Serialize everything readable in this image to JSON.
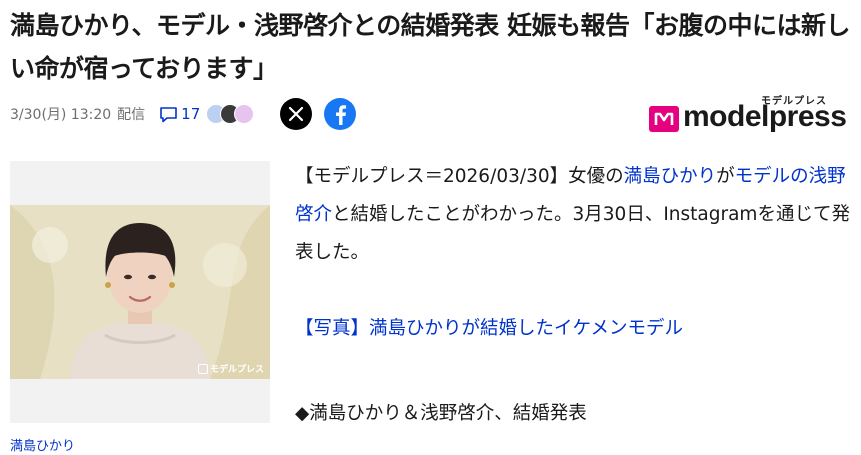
{
  "headline": "満島ひかり、モデル・浅野啓介との結婚発表 妊娠も報告「お腹の中には新しい命が宿っております」",
  "meta": {
    "datetime": "3/30(月) 13:20",
    "source_label": "配信",
    "comment_count": "17"
  },
  "share": {
    "x_icon": "x-logo-icon",
    "facebook_icon": "facebook-icon"
  },
  "logo": {
    "kana": "モデルプレス",
    "text": "modelpress"
  },
  "photo": {
    "watermark": "モデルプレス",
    "caption": "満島ひかり"
  },
  "article": {
    "p1_prefix": "【モデルプレス＝2026/03/30】女優の",
    "p1_link1": "満島ひかり",
    "p1_mid": "が",
    "p1_link2": "モデルの浅野啓介",
    "p1_suffix": "と結婚したことがわかった。3月30日、Instagramを通じて発表した。",
    "photo_link": "【写真】満島ひかりが結婚したイケメンモデル",
    "section_heading": "◆満島ひかり＆浅野啓介、結婚発表"
  },
  "colors": {
    "link": "#0033cc",
    "brand_pink": "#e4007f",
    "facebook": "#1877f2"
  }
}
